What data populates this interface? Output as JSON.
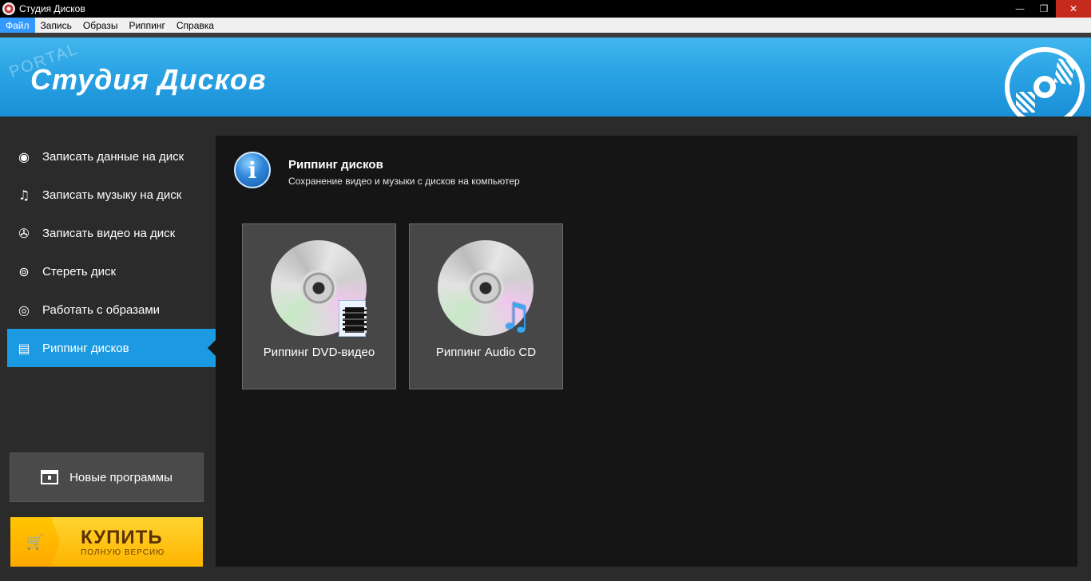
{
  "window": {
    "title": "Студия Дисков",
    "controls": [
      "minimize",
      "restore",
      "close"
    ]
  },
  "menu": [
    "Файл",
    "Запись",
    "Образы",
    "Риппинг",
    "Справка"
  ],
  "banner": {
    "title": "Студия Дисков",
    "watermark": "PORTAL"
  },
  "sidebar": {
    "items": [
      {
        "label": "Записать данные на диск",
        "icon": "disc-icon"
      },
      {
        "label": "Записать музыку на диск",
        "icon": "music-note-icon"
      },
      {
        "label": "Записать видео на диск",
        "icon": "film-reel-icon"
      },
      {
        "label": "Стереть диск",
        "icon": "erase-disc-icon"
      },
      {
        "label": "Работать с образами",
        "icon": "eye-icon"
      },
      {
        "label": "Риппинг дисков",
        "icon": "sd-card-icon",
        "active": true
      }
    ],
    "new_programs": "Новые программы",
    "buy": {
      "title": "КУПИТЬ",
      "subtitle": "ПОЛНУЮ ВЕРСИЮ"
    }
  },
  "main": {
    "title": "Риппинг дисков",
    "subtitle": "Сохранение видео и музыки с дисков на компьютер",
    "tiles": [
      {
        "label": "Риппинг DVD-видео",
        "icon": "dvd-video-icon"
      },
      {
        "label": "Риппинг Audio CD",
        "icon": "audio-cd-icon"
      }
    ]
  },
  "colors": {
    "accent": "#1c9ae1",
    "banner": "#2aa3e4",
    "buy": "#ffc600",
    "panel": "#151515"
  }
}
